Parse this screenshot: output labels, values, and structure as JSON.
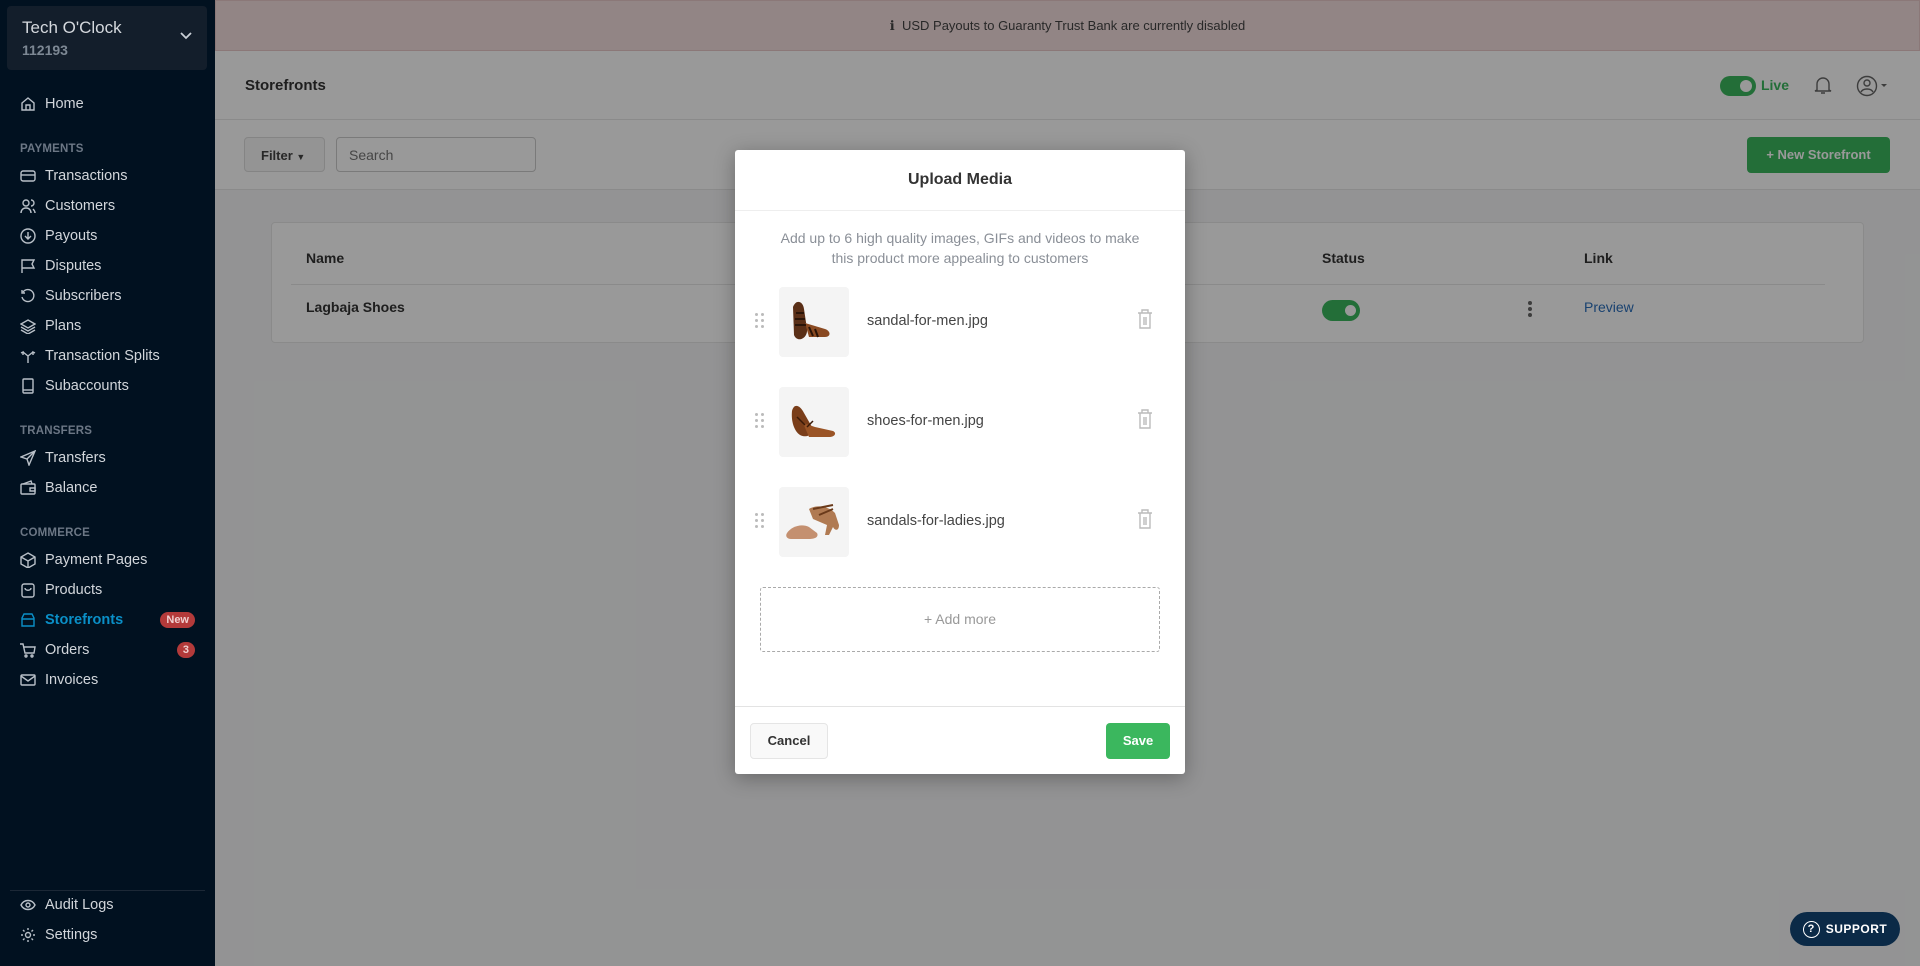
{
  "org": {
    "name": "Tech O'Clock",
    "id": "112193"
  },
  "sidebar": {
    "home": "Home",
    "sections": {
      "payments": "PAYMENTS",
      "transfers": "TRANSFERS",
      "commerce": "COMMERCE"
    },
    "payments": [
      "Transactions",
      "Customers",
      "Payouts",
      "Disputes",
      "Subscribers",
      "Plans",
      "Transaction Splits",
      "Subaccounts"
    ],
    "transfers": [
      "Transfers",
      "Balance"
    ],
    "commerce": [
      "Payment Pages",
      "Products",
      "Storefronts",
      "Orders",
      "Invoices"
    ],
    "storefronts_badge": "New",
    "orders_badge": "3",
    "footer": [
      "Audit Logs",
      "Settings"
    ],
    "active": "Storefronts"
  },
  "banner": {
    "icon": "info-icon",
    "text": "USD Payouts to Guaranty Trust Bank are currently disabled"
  },
  "header": {
    "title": "Storefronts",
    "live_label": "Live",
    "live_on": true
  },
  "toolbar": {
    "filter_label": "Filter",
    "search_placeholder": "Search",
    "new_label": "+ New Storefront"
  },
  "table": {
    "columns": {
      "name": "Name",
      "status": "Status",
      "link": "Link"
    },
    "rows": [
      {
        "name": "Lagbaja Shoes",
        "status_on": true,
        "link": "Preview"
      }
    ]
  },
  "modal": {
    "title": "Upload Media",
    "description": "Add up to 6 high quality images, GIFs and videos to make this product more appealing to customers",
    "items": [
      {
        "filename": "sandal-for-men.jpg"
      },
      {
        "filename": "shoes-for-men.jpg"
      },
      {
        "filename": "sandals-for-ladies.jpg"
      }
    ],
    "add_more": "+ Add more",
    "cancel": "Cancel",
    "save": "Save"
  },
  "support": {
    "label": "SUPPORT"
  },
  "colors": {
    "sidebar_bg": "#011120",
    "accent_green": "#3bb75e",
    "active_blue": "#0a8fc7",
    "badge_red": "#b33a3a"
  }
}
